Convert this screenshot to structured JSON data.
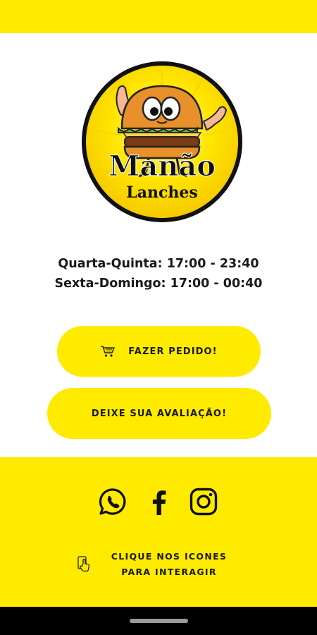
{
  "logo": {
    "brand_line1": "Manão",
    "brand_line2": "Lanches"
  },
  "hours": [
    "Quarta-Quinta: 17:00 - 23:40",
    "Sexta-Domingo: 17:00 - 00:40"
  ],
  "buttons": {
    "order_label": "FAZER PEDIDO!",
    "order_icon": "cart-icon",
    "review_label": "DEIXE SUA AVALIAÇÃO!"
  },
  "footer": {
    "social_icons": [
      "whatsapp-icon",
      "facebook-icon",
      "instagram-icon"
    ],
    "hint_icon": "tap-hand-icon",
    "hint_line1": "CLIQUE NOS ICONES",
    "hint_line2": "PARA INTERAGIR"
  },
  "colors": {
    "accent": "#FFEB00",
    "text": "#1a1a1a",
    "background": "#ffffff",
    "nav_bar": "#000000"
  }
}
